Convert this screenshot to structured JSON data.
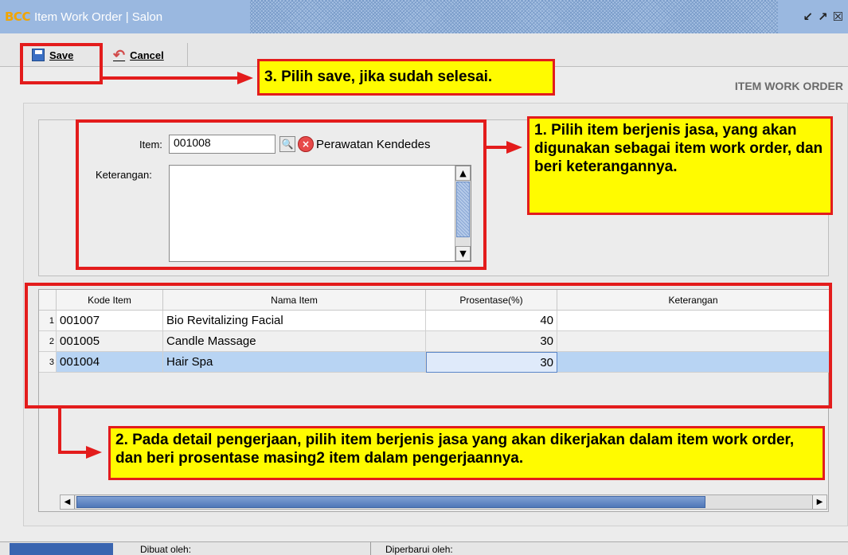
{
  "window": {
    "logo": "BCC",
    "title": "Item Work Order | Salon"
  },
  "toolbar": {
    "save_label": "Save",
    "cancel_label": "Cancel"
  },
  "page_header": "ITEM WORK ORDER",
  "form": {
    "item_label": "Item:",
    "item_code": "001008",
    "item_name": "Perawatan Kendedes",
    "keterangan_label": "Keterangan:",
    "keterangan_value": ""
  },
  "grid": {
    "columns": [
      "Kode Item",
      "Nama Item",
      "Prosentase(%)",
      "Keterangan"
    ],
    "rows": [
      {
        "no": "1",
        "kode": "001007",
        "nama": "Bio  Revitalizing Facial",
        "persen": "40",
        "ket": ""
      },
      {
        "no": "2",
        "kode": "001005",
        "nama": "Candle Massage",
        "persen": "30",
        "ket": ""
      },
      {
        "no": "3",
        "kode": "001004",
        "nama": "Hair Spa",
        "persen": "30",
        "ket": ""
      }
    ]
  },
  "footer": {
    "created_by": "Dibuat oleh:",
    "updated_by": "Diperbarui oleh:"
  },
  "annotations": {
    "note1": "1. Pilih item berjenis jasa, yang akan digunakan sebagai item work order, dan beri keterangannya.",
    "note2": "2. Pada detail pengerjaan, pilih item berjenis jasa yang akan dikerjakan dalam item work order, dan beri prosentase masing2 item dalam pengerjaannya.",
    "note3": "3. Pilih save, jika sudah selesai."
  },
  "colors": {
    "title_bar": "#9ab8e0",
    "annotation_bg": "#fffb00",
    "annotation_border": "#e31c1c",
    "selected_row": "#b8d4f3"
  }
}
